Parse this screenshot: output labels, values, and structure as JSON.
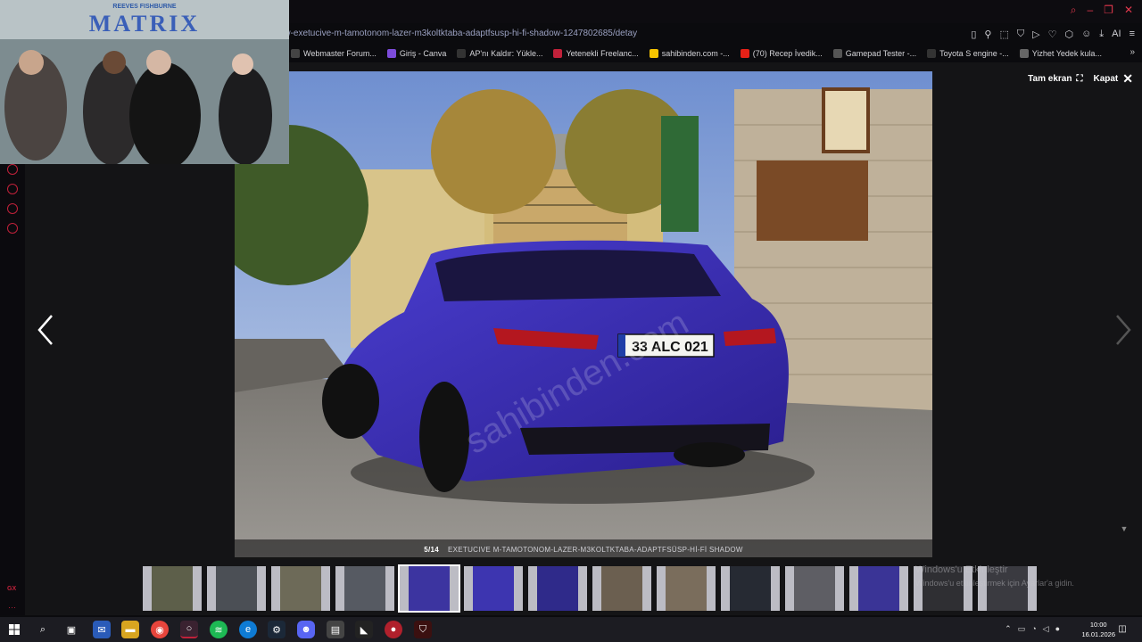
{
  "browser": {
    "url": "mw-exetucive-m-tamotonom-lazer-m3koltktaba-adaptfsusp-hi-fi-shadow-1247802685/detay",
    "bookmarks": [
      {
        "label": "Webmaster Forum...",
        "color": "#444"
      },
      {
        "label": "Giriş - Canva",
        "color": "#7d4cdb"
      },
      {
        "label": "AP'nı Kaldır: Yükle...",
        "color": "#333"
      },
      {
        "label": "Yetenekli Freelanc...",
        "color": "#c0213a"
      },
      {
        "label": "sahibinden.com -...",
        "color": "#f5c400"
      },
      {
        "label": "(70) Recep İvedik...",
        "color": "#e62117"
      },
      {
        "label": "Gamepad Tester -...",
        "color": "#555"
      },
      {
        "label": "Toyota S engine -...",
        "color": "#333"
      },
      {
        "label": "Yizhet Yedek kula...",
        "color": "#666"
      }
    ],
    "more_label": "»"
  },
  "viewer": {
    "fullscreen_label": "Tam ekran",
    "close_label": "Kapat",
    "counter": "5/14",
    "title": "EXETUCIVE M-TAMOTONOM-LAZER-M3KOLTKTABA-ADAPTFSÜSP-Hİ-Fİ SHADOW",
    "plate": "33 ALC 021",
    "watermark": "sahibinden.com",
    "thumb_count": 14,
    "active_thumb": 4
  },
  "pip_video": {
    "actors_line": "REEVES        FISHBURNE",
    "title": "MATRIX"
  },
  "windows": {
    "activation_title": "Windows'u Etkinleştir",
    "activation_sub": "Windows'u etkinleştirmek için Ayarlar'a gidin.",
    "time": "10:00",
    "date": "16.01.2026",
    "gx_label": "GX"
  },
  "colors": {
    "accent": "#c0213a",
    "car": "#3a2bb8"
  }
}
